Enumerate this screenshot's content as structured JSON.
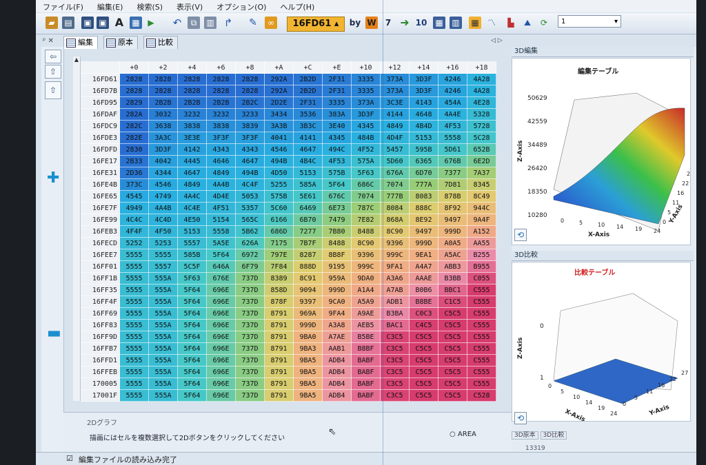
{
  "menu": [
    "ファイル(F)",
    "編集(E)",
    "検索(S)",
    "表示(V)",
    "オプション(O)",
    "ヘルプ(H)"
  ],
  "toolbar": {
    "address": "16FD61",
    "by_label": "by",
    "w_label": "W",
    "seven_label": "7",
    "ten_label": "10",
    "combo_value": "1"
  },
  "tabs": [
    "編集",
    "原本",
    "比較"
  ],
  "grid": {
    "columns": [
      "+0",
      "+2",
      "+4",
      "+6",
      "+8",
      "+A",
      "+C",
      "+E",
      "+10",
      "+12",
      "+14",
      "+16",
      "+18"
    ],
    "rows": [
      {
        "addr": "16FD61",
        "cells": [
          "2828",
          "2828",
          "2828",
          "2828",
          "2828",
          "292A",
          "2B2D",
          "2F31",
          "3335",
          "373A",
          "3D3F",
          "4246",
          "4A28"
        ]
      },
      {
        "addr": "16FD7B",
        "cells": [
          "2828",
          "2828",
          "2828",
          "2828",
          "2828",
          "292A",
          "2B2D",
          "2F31",
          "3335",
          "373A",
          "3D3F",
          "4246",
          "4A28"
        ]
      },
      {
        "addr": "16FD95",
        "cells": [
          "2829",
          "2B2B",
          "2B2B",
          "2B2B",
          "2B2C",
          "2D2E",
          "2F31",
          "3335",
          "373A",
          "3C3E",
          "4143",
          "454A",
          "4E28"
        ]
      },
      {
        "addr": "16FDAF",
        "cells": [
          "282A",
          "3032",
          "3232",
          "3232",
          "3233",
          "3434",
          "3536",
          "383A",
          "3D3F",
          "4144",
          "4648",
          "4A4E",
          "5328"
        ]
      },
      {
        "addr": "16FDC9",
        "cells": [
          "282C",
          "3638",
          "3838",
          "3838",
          "3839",
          "3A3B",
          "3B3C",
          "3E40",
          "4345",
          "4849",
          "4B4D",
          "4F53",
          "5728"
        ]
      },
      {
        "addr": "16FDE3",
        "cells": [
          "282E",
          "3A3C",
          "3E3E",
          "3F3F",
          "3F3F",
          "4041",
          "4141",
          "4345",
          "484B",
          "4D4F",
          "5153",
          "5558",
          "5C28"
        ]
      },
      {
        "addr": "16FDFD",
        "cells": [
          "2830",
          "3D3F",
          "4142",
          "4343",
          "4343",
          "4546",
          "4647",
          "494C",
          "4F52",
          "5457",
          "595B",
          "5D61",
          "652B"
        ]
      },
      {
        "addr": "16FE17",
        "cells": [
          "2B33",
          "4042",
          "4445",
          "4646",
          "4647",
          "494B",
          "4B4C",
          "4F53",
          "575A",
          "5D60",
          "6365",
          "676B",
          "6E2D"
        ]
      },
      {
        "addr": "16FE31",
        "cells": [
          "2D36",
          "4344",
          "4647",
          "4849",
          "494B",
          "4D50",
          "5153",
          "575B",
          "5F63",
          "676A",
          "6D70",
          "7377",
          "7A37"
        ]
      },
      {
        "addr": "16FE4B",
        "cells": [
          "373C",
          "4546",
          "4849",
          "4A4B",
          "4C4F",
          "5255",
          "585A",
          "5F64",
          "686C",
          "7074",
          "777A",
          "7D81",
          "8345"
        ]
      },
      {
        "addr": "16FE65",
        "cells": [
          "4545",
          "4749",
          "4A4C",
          "4D4E",
          "5053",
          "575B",
          "5E61",
          "676C",
          "7074",
          "777B",
          "8083",
          "878B",
          "8C49"
        ]
      },
      {
        "addr": "16FE7F",
        "cells": [
          "4949",
          "4A4B",
          "4C4E",
          "4F51",
          "5357",
          "5C60",
          "6469",
          "6E73",
          "787C",
          "8084",
          "888C",
          "8F92",
          "944C"
        ]
      },
      {
        "addr": "16FE99",
        "cells": [
          "4C4C",
          "4C4D",
          "4E50",
          "5154",
          "565C",
          "6166",
          "6B70",
          "7479",
          "7E82",
          "868A",
          "8E92",
          "9497",
          "9A4F"
        ]
      },
      {
        "addr": "16FEB3",
        "cells": [
          "4F4F",
          "4F50",
          "5153",
          "5558",
          "5B62",
          "686D",
          "7277",
          "7B80",
          "8488",
          "8C90",
          "9497",
          "999D",
          "A152"
        ]
      },
      {
        "addr": "16FECD",
        "cells": [
          "5252",
          "5253",
          "5557",
          "5A5E",
          "626A",
          "7175",
          "7B7F",
          "8488",
          "8C90",
          "9396",
          "999D",
          "A0A5",
          "AA55"
        ]
      },
      {
        "addr": "16FEE7",
        "cells": [
          "5555",
          "5555",
          "585B",
          "5F64",
          "6972",
          "797E",
          "8287",
          "8B8F",
          "9396",
          "999C",
          "9EA1",
          "A5AC",
          "B255"
        ]
      },
      {
        "addr": "16FF01",
        "cells": [
          "5555",
          "5557",
          "5C5F",
          "646A",
          "6F79",
          "7F84",
          "888D",
          "9195",
          "999C",
          "9FA1",
          "A4A7",
          "ABB3",
          "B955"
        ]
      },
      {
        "addr": "16FF1B",
        "cells": [
          "5555",
          "555A",
          "5F63",
          "676E",
          "737D",
          "8389",
          "8C91",
          "959A",
          "9DA0",
          "A3A6",
          "AAAE",
          "B3BB",
          "C055"
        ]
      },
      {
        "addr": "16FF35",
        "cells": [
          "5555",
          "555A",
          "5F64",
          "696E",
          "737D",
          "858D",
          "9094",
          "999D",
          "A1A4",
          "A7AB",
          "B0B6",
          "BBC1",
          "C555"
        ]
      },
      {
        "addr": "16FF4F",
        "cells": [
          "5555",
          "555A",
          "5F64",
          "696E",
          "737D",
          "878F",
          "9397",
          "9CA0",
          "A5A9",
          "ADB1",
          "B8BE",
          "C1C5",
          "C555"
        ]
      },
      {
        "addr": "16FF69",
        "cells": [
          "5555",
          "555A",
          "5F64",
          "696E",
          "737D",
          "8791",
          "969A",
          "9FA4",
          "A9AE",
          "B3BA",
          "C0C3",
          "C5C5",
          "C555"
        ]
      },
      {
        "addr": "16FF83",
        "cells": [
          "5555",
          "555A",
          "5F64",
          "696E",
          "737D",
          "8791",
          "999D",
          "A3A8",
          "AEB5",
          "BAC1",
          "C4C5",
          "C5C5",
          "C555"
        ]
      },
      {
        "addr": "16FF9D",
        "cells": [
          "5555",
          "555A",
          "5F64",
          "696E",
          "737D",
          "8791",
          "9BA0",
          "A7AE",
          "B5BE",
          "C3C5",
          "C5C5",
          "C5C5",
          "C555"
        ]
      },
      {
        "addr": "16FFB7",
        "cells": [
          "5555",
          "555A",
          "5F64",
          "696E",
          "737D",
          "8791",
          "9BA3",
          "AAB1",
          "B8BF",
          "C3C5",
          "C5C5",
          "C5C5",
          "C555"
        ]
      },
      {
        "addr": "16FFD1",
        "cells": [
          "5555",
          "555A",
          "5F64",
          "696E",
          "737D",
          "8791",
          "9BA5",
          "ADB4",
          "BABF",
          "C3C5",
          "C5C5",
          "C5C5",
          "C555"
        ]
      },
      {
        "addr": "16FFEB",
        "cells": [
          "5555",
          "555A",
          "5F64",
          "696E",
          "737D",
          "8791",
          "9BA5",
          "ADB4",
          "BABF",
          "C3C5",
          "C5C5",
          "C5C5",
          "C555"
        ]
      },
      {
        "addr": "170005",
        "cells": [
          "5555",
          "555A",
          "5F64",
          "696E",
          "737D",
          "8791",
          "9BA5",
          "ADB4",
          "BABF",
          "C3C5",
          "C5C5",
          "C5C5",
          "C555"
        ]
      },
      {
        "addr": "17001F",
        "cells": [
          "5555",
          "555A",
          "5F64",
          "696E",
          "737D",
          "8791",
          "9BA5",
          "ADB4",
          "BABF",
          "C3C5",
          "C5C5",
          "C5C5",
          "C528"
        ]
      }
    ]
  },
  "chart_data": [
    {
      "type": "surface3d",
      "title": "編集テーブル",
      "xlabel": "X-Axis",
      "ylabel": "Y-Axis",
      "zlabel": "Z-Axis",
      "x_ticks": [
        "0",
        "5",
        "10",
        "14",
        "19",
        "24"
      ],
      "y_ticks": [
        "0",
        "5",
        "11",
        "16",
        "22",
        "27"
      ],
      "z_ticks": [
        "10280",
        "18350",
        "26420",
        "34489",
        "42559",
        "50629"
      ]
    },
    {
      "type": "surface3d",
      "title": "比較テーブル",
      "xlabel": "X-Axis",
      "ylabel": "Y-Axis",
      "zlabel": "Z-Axis",
      "x_ticks": [
        "0",
        "5",
        "10",
        "14",
        "19",
        "24"
      ],
      "y_ticks": [
        "0",
        "5",
        "11",
        "16",
        "22",
        "27"
      ],
      "z_ticks": [
        "1",
        "0"
      ]
    }
  ],
  "panes": {
    "edit3d": "3D編集",
    "compare3d": "3D比較",
    "graph2d": "2Dグラフ",
    "hint": "描画にはセルを複数選択して2Dボタンをクリックしてください",
    "area": "AREA",
    "tab_original": "3D原本",
    "tab_compare": "3D比較",
    "count": "13319"
  },
  "status": "編集ファイルの読み込み完了"
}
